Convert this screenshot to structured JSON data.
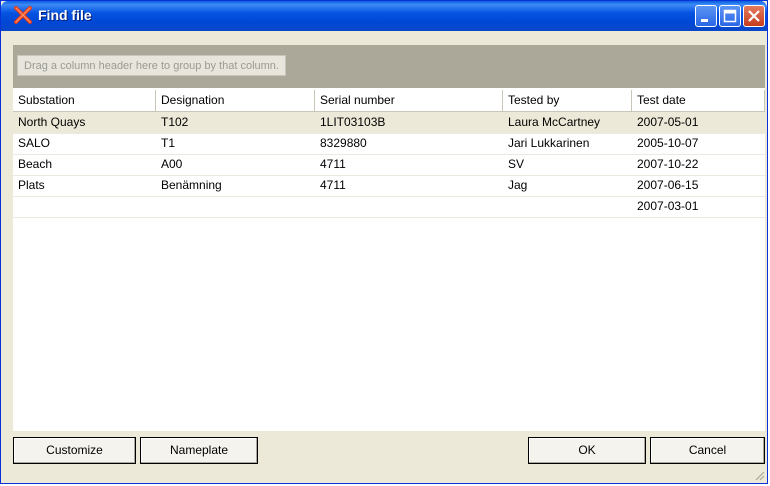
{
  "window": {
    "title": "Find file",
    "colors": {
      "titlebar": "#0553e0",
      "body": "#ece9d8",
      "group_panel": "#aca899"
    }
  },
  "titlebar_buttons": [
    "minimize-icon",
    "maximize-icon",
    "close-icon"
  ],
  "group_panel": {
    "hint": "Drag a column header here to group by that column."
  },
  "table": {
    "columns": [
      "Substation",
      "Designation",
      "Serial number",
      "Tested by",
      "Test date"
    ],
    "rows": [
      [
        "North Quays",
        "T102",
        "1LIT03103B",
        "Laura McCartney",
        "2007-05-01"
      ],
      [
        "SALO",
        "T1",
        "8329880",
        "Jari Lukkarinen",
        "2005-10-07"
      ],
      [
        "Beach",
        "A00",
        "4711",
        "SV",
        "2007-10-22"
      ],
      [
        "Plats",
        "Benämning",
        "4711",
        "Jag",
        "2007-06-15"
      ],
      [
        "",
        "",
        "",
        "",
        "2007-03-01"
      ]
    ]
  },
  "buttons": {
    "customize": "Customize",
    "nameplate": "Nameplate",
    "ok": "OK",
    "cancel": "Cancel"
  }
}
